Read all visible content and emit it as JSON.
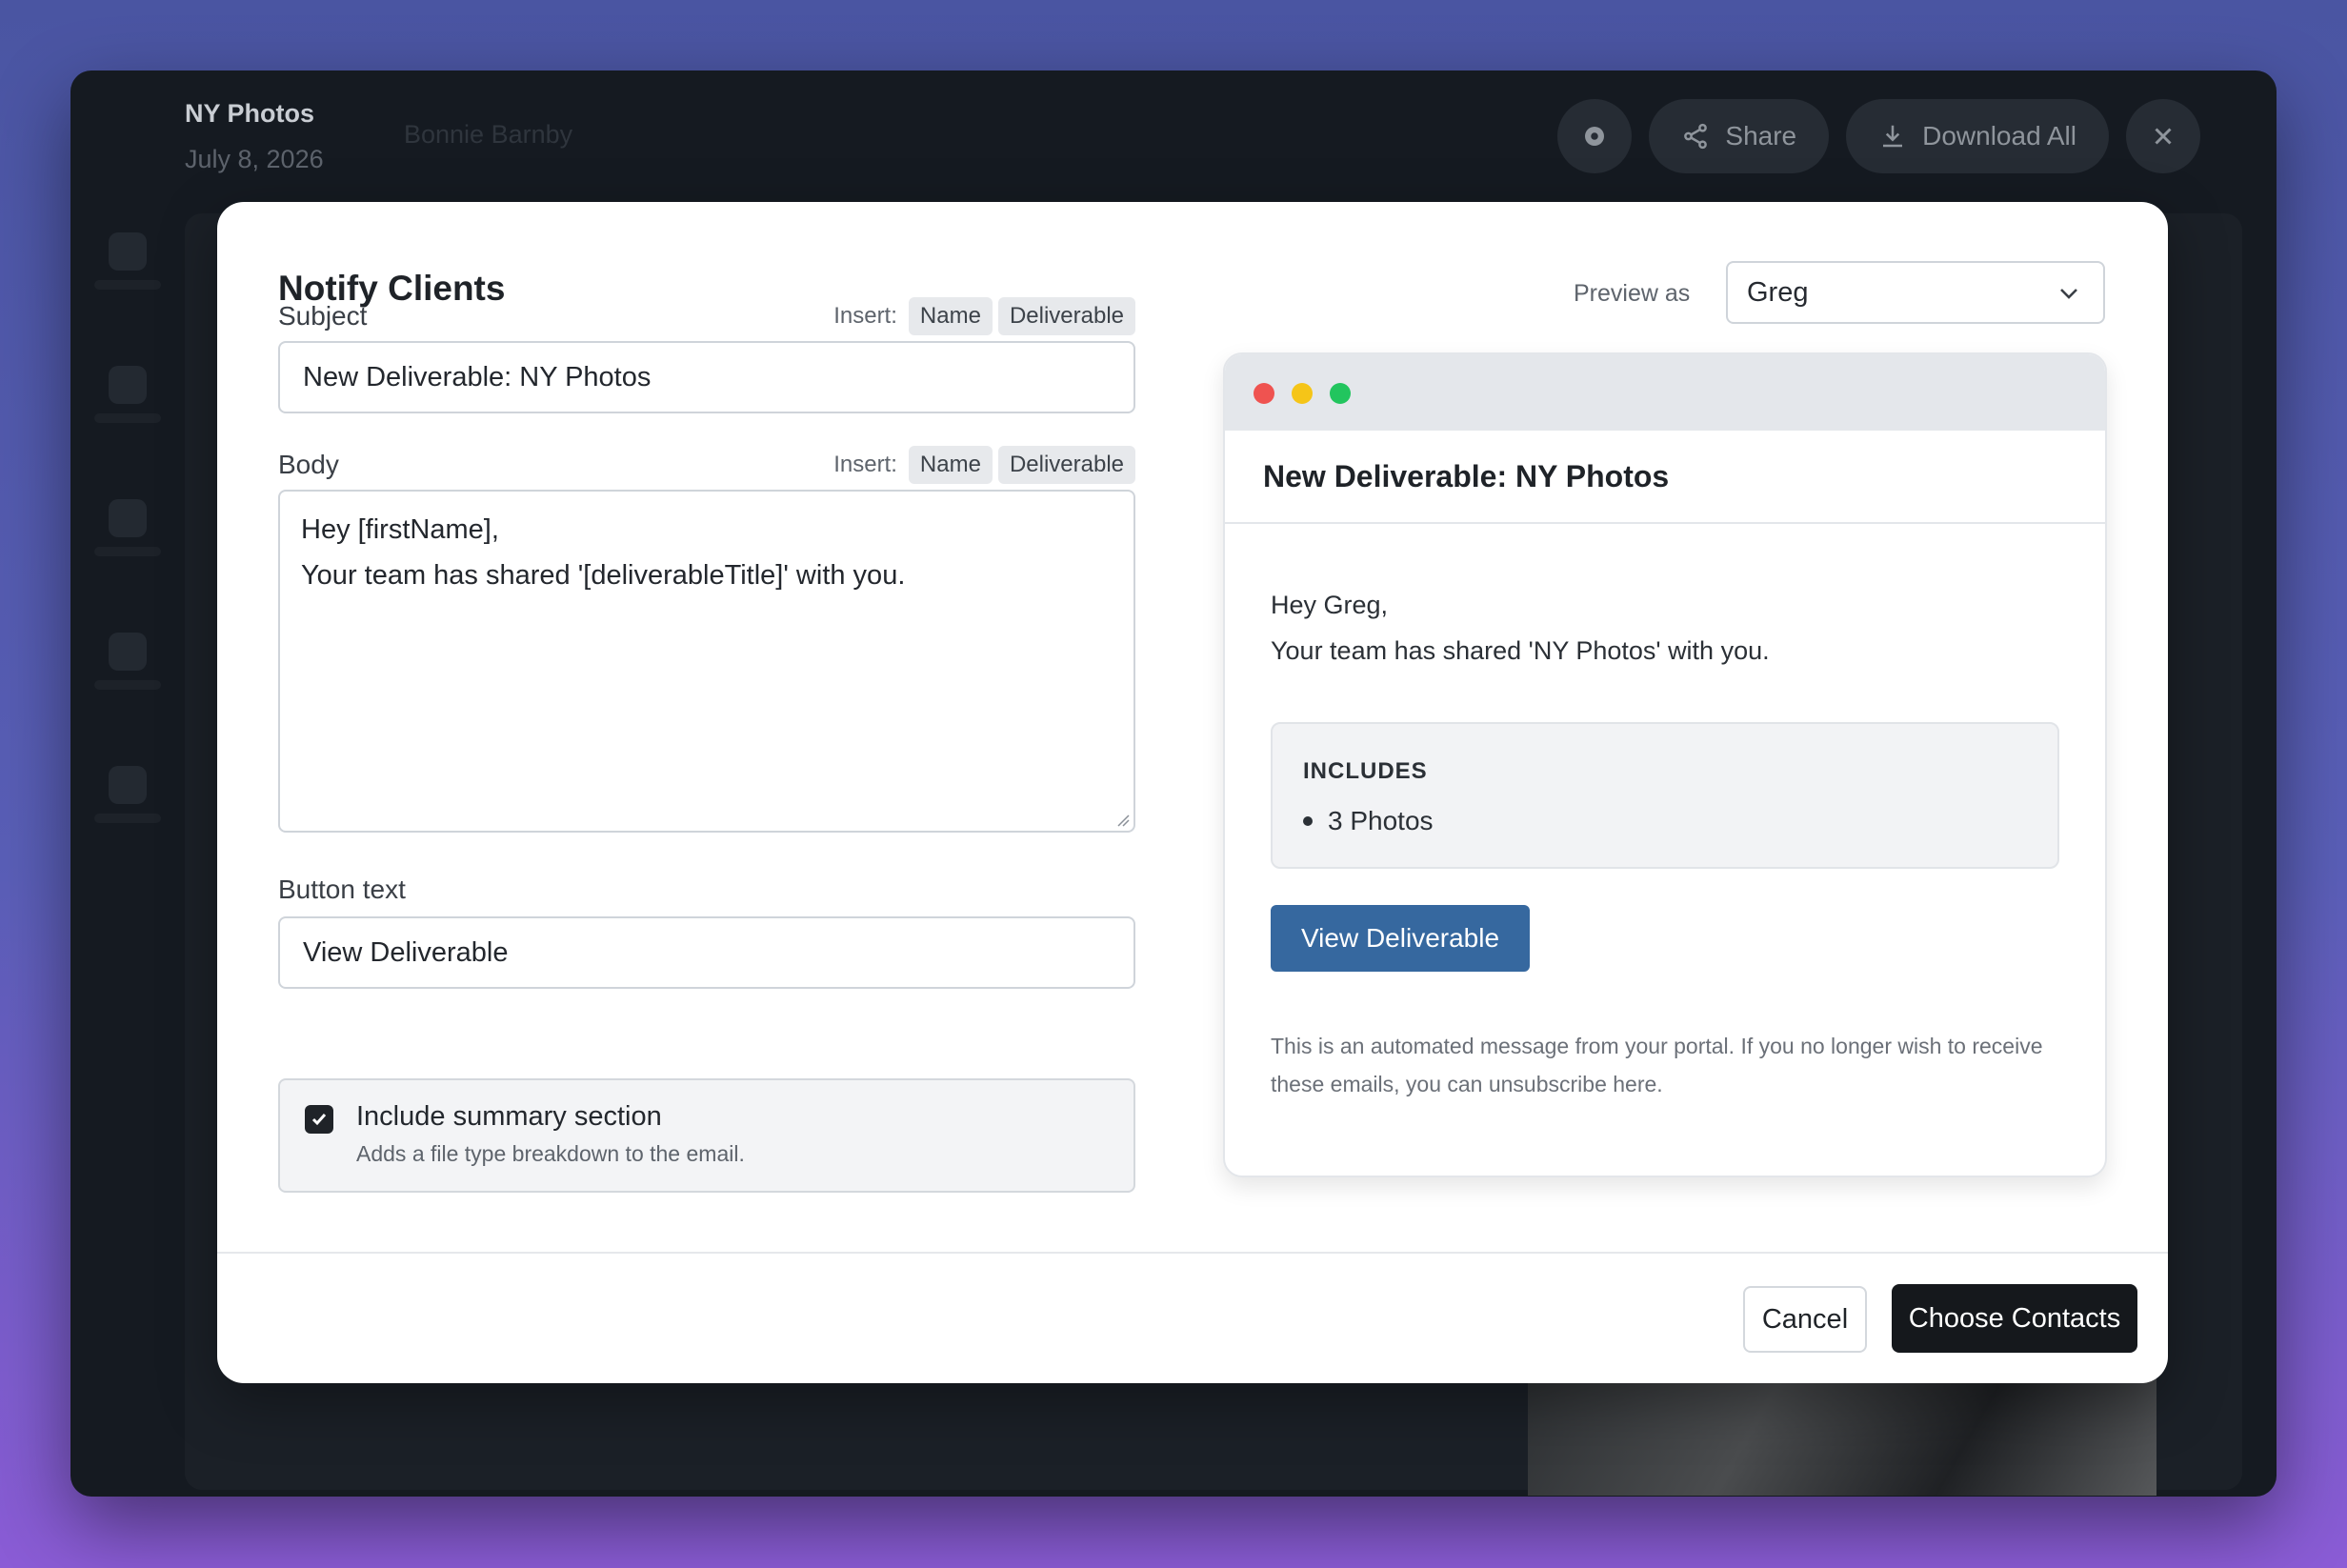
{
  "app": {
    "title": "NY Photos",
    "date": "July 8, 2026",
    "crumb": "Bonnie Barnby",
    "actions": {
      "share": "Share",
      "download_all": "Download All"
    }
  },
  "modal": {
    "title": "Notify Clients",
    "preview_as_label": "Preview as",
    "preview_as_value": "Greg",
    "subject": {
      "label": "Subject",
      "insert_label": "Insert:",
      "chips": [
        "Name",
        "Deliverable"
      ],
      "value": "New Deliverable: NY Photos"
    },
    "body": {
      "label": "Body",
      "insert_label": "Insert:",
      "chips": [
        "Name",
        "Deliverable"
      ],
      "lines": [
        "Hey [firstName],",
        "Your team has shared '[deliverableTitle]' with you."
      ]
    },
    "button_text": {
      "label": "Button text",
      "value": "View Deliverable"
    },
    "summary": {
      "checked": true,
      "title": "Include summary section",
      "subtitle": "Adds a file type breakdown to the email."
    },
    "footer": {
      "cancel": "Cancel",
      "choose_contacts": "Choose Contacts"
    }
  },
  "email_preview": {
    "subject": "New Deliverable: NY Photos",
    "greeting": "Hey Greg,",
    "message": "Your team has shared 'NY Photos' with you.",
    "includes_title": "INCLUDES",
    "includes_items": [
      "3 Photos"
    ],
    "button": "View Deliverable",
    "disclaimer": "This is an automated message from your portal. If you no longer wish to receive these emails, you can unsubscribe here.",
    "window_dots": [
      "#ef5350",
      "#f5c518",
      "#22c55e"
    ],
    "button_color": "#36689f"
  }
}
